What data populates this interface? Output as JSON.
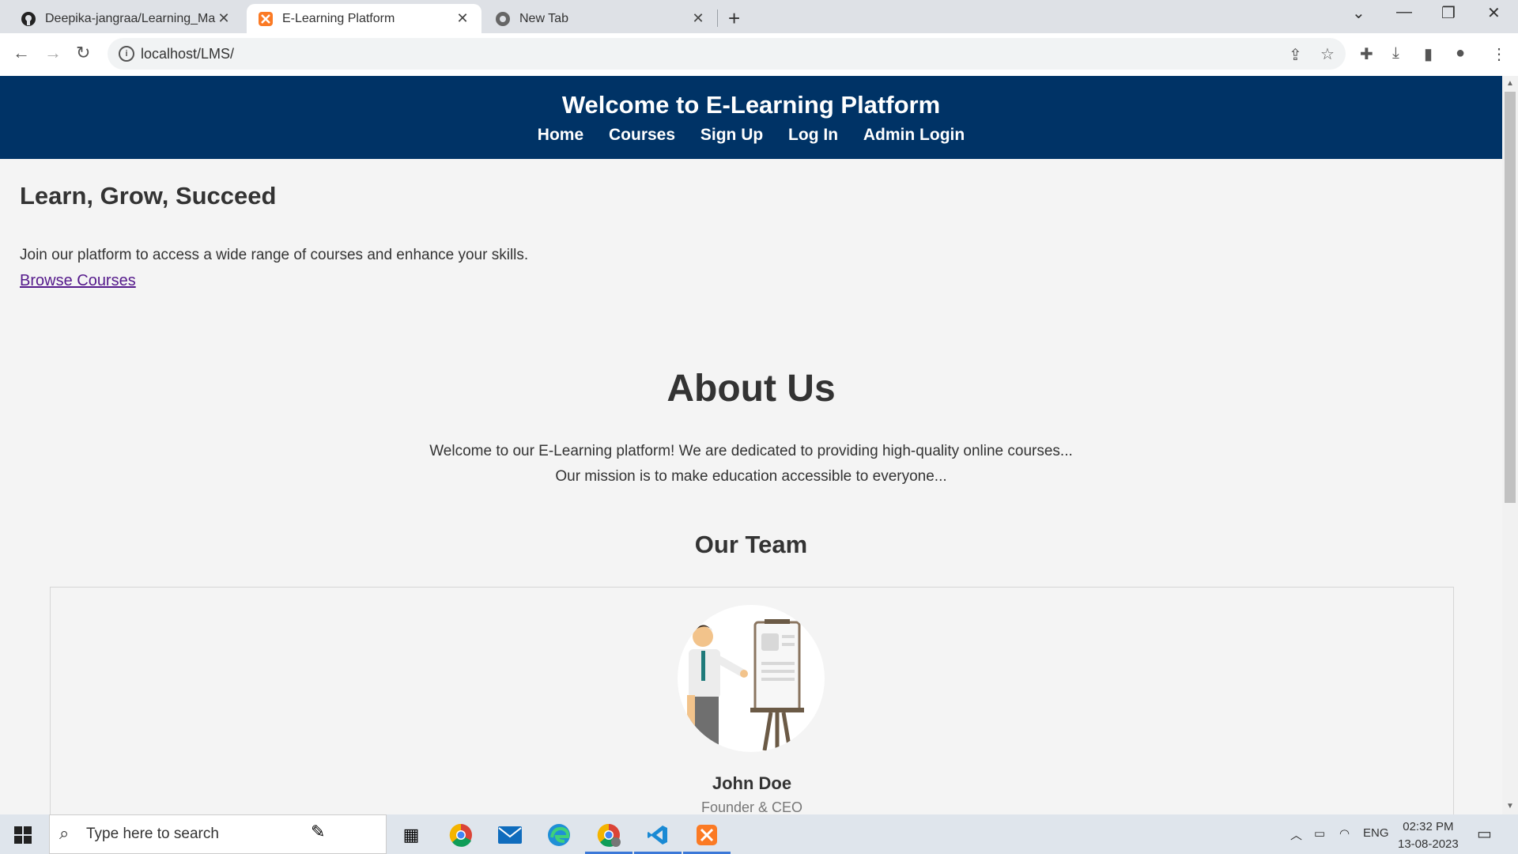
{
  "browser": {
    "tabs": [
      {
        "title": "Deepika-jangraa/Learning_Mana",
        "icon": "github-icon"
      },
      {
        "title": "E-Learning Platform",
        "icon": "xampp-icon"
      },
      {
        "title": "New Tab",
        "icon": "chrome-icon"
      }
    ],
    "url": "localhost/LMS/"
  },
  "site": {
    "title": "Welcome to E-Learning Platform",
    "nav": [
      "Home",
      "Courses",
      "Sign Up",
      "Log In",
      "Admin Login"
    ],
    "hero": {
      "heading": "Learn, Grow, Succeed",
      "text": "Join our platform to access a wide range of courses and enhance your skills.",
      "link": "Browse Courses"
    },
    "about": {
      "heading": "About Us",
      "line1": "Welcome to our E-Learning platform! We are dedicated to providing high-quality online courses...",
      "line2": "Our mission is to make education accessible to everyone..."
    },
    "team": {
      "heading": "Our Team",
      "members": [
        {
          "name": "John Doe",
          "role": "Founder & CEO"
        }
      ]
    }
  },
  "taskbar": {
    "search_placeholder": "Type here to search",
    "language": "ENG",
    "time": "02:32 PM",
    "date": "13-08-2023"
  },
  "colors": {
    "header_bg": "#003366",
    "link_visited": "#551a8b",
    "page_bg": "#f4f4f4"
  }
}
